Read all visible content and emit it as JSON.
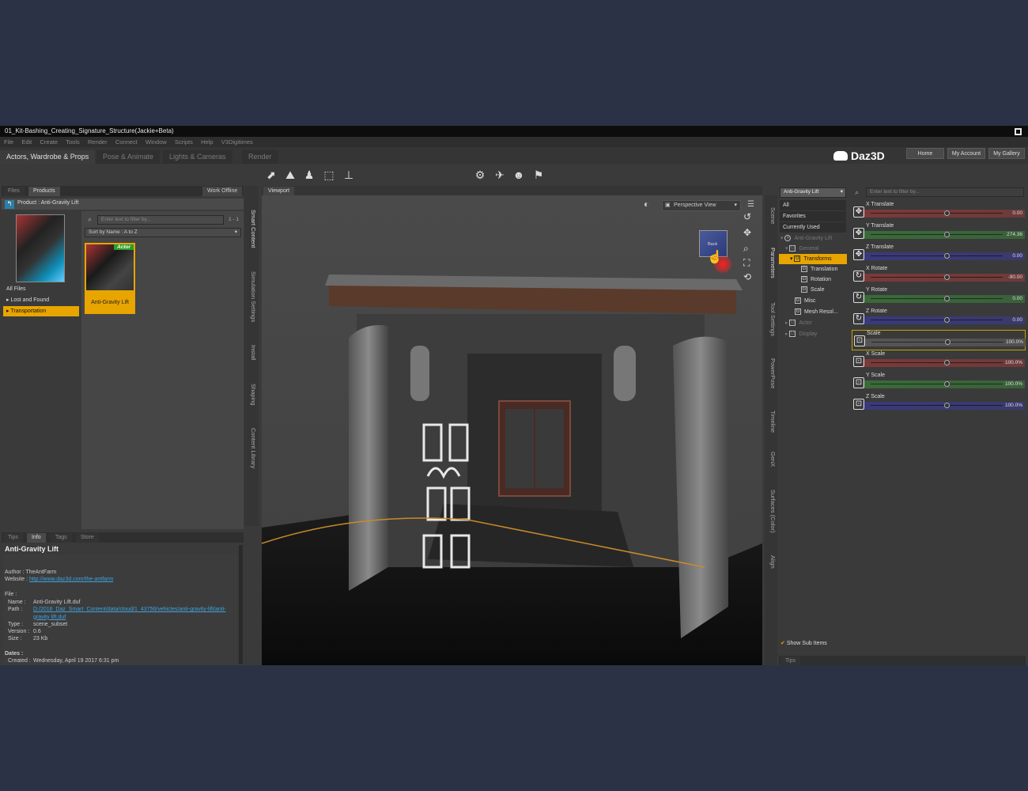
{
  "window": {
    "title": "01_Kit-Bashing_Creating_Signature_Structure(Jackie+Beta)"
  },
  "menu": [
    "File",
    "Edit",
    "Create",
    "Tools",
    "Render",
    "Connect",
    "Window",
    "Scripts",
    "Help",
    "V3Digitimes"
  ],
  "workspace_tabs": [
    "Actors, Wardrobe & Props",
    "Pose & Animate",
    "Lights & Cameras",
    "Render"
  ],
  "brand": {
    "logo": "Daz3D",
    "buttons": [
      "Home",
      "My Account",
      "My Gallery"
    ]
  },
  "left": {
    "tabs": [
      "Files",
      "Products"
    ],
    "work_offline": "Work Offline",
    "product_label": "Product :  Anti-Gravity Lift",
    "filter_placeholder": "Enter text to filter by...",
    "count": "1 - 1",
    "sort": "Sort by Name : A to Z",
    "categories": [
      "All Files",
      "Lost and Found",
      "Transportation"
    ],
    "item": {
      "badge": "Actor",
      "name": "Anti-Gravity Lift"
    },
    "side_tabs": [
      "Smart Content",
      "Simulation Settings",
      "Install",
      "Shaping",
      "Content Library"
    ]
  },
  "info": {
    "tabs": [
      "Tips",
      "Info",
      "Tags",
      "Store"
    ],
    "title": "Anti-Gravity Lift",
    "author_label": "Author :",
    "author": "TheAntFarm",
    "website_label": "Website :",
    "website": "http://www.daz3d.com/the-antfarm",
    "file_label": "File :",
    "name_label": "Name :",
    "name": "Anti-Gravity Lift.duf",
    "path_label": "Path :",
    "path": "D:/2016_Daz_Smart_Content/data/cloud/1_43756/vehicles/anti-gravity-lift/anti-gravity lift.duf",
    "type_label": "Type :",
    "type": "scene_subset",
    "version_label": "Version :",
    "version": "0.6",
    "size_label": "Size :",
    "size": "23 Kb",
    "dates_label": "Dates :",
    "created_label": "Created :",
    "created": "Wednesday, April 19 2017 6:31 pm"
  },
  "viewport": {
    "tab": "Viewport",
    "view": "Perspective View",
    "cube_label": "Back"
  },
  "scene": {
    "selector": "Anti-Gravity Lift",
    "filters": [
      "All",
      "Favorites",
      "Currently Used"
    ],
    "tree": [
      "Anti-Gravity Lift",
      "General",
      "Transforms",
      "Translation",
      "Rotation",
      "Scale",
      "Misc",
      "Mesh Resol...",
      "Actor",
      "Display"
    ],
    "show_sub": "Show Sub Items",
    "bottom_tab": "Tips",
    "side_tabs": [
      "Scene",
      "Parameters",
      "Tool Settings",
      "PowerPose",
      "Timeline",
      "GenX",
      "Surfaces (Color)",
      "Align"
    ]
  },
  "params": {
    "filter_placeholder": "Enter text to filter by...",
    "items": [
      {
        "label": "X Translate",
        "value": "0.00",
        "color": "#7a3a3a"
      },
      {
        "label": "Y Translate",
        "value": "274.36",
        "color": "#3a6a3a"
      },
      {
        "label": "Z Translate",
        "value": "0.00",
        "color": "#3a3a7a"
      },
      {
        "label": "X Rotate",
        "value": "-90.00",
        "color": "#7a3a3a"
      },
      {
        "label": "Y Rotate",
        "value": "0.00",
        "color": "#3a6a3a"
      },
      {
        "label": "Z Rotate",
        "value": "0.00",
        "color": "#3a3a7a"
      },
      {
        "label": "Scale",
        "value": "100.0%",
        "color": "#555555"
      },
      {
        "label": "X Scale",
        "value": "100.0%",
        "color": "#7a3a3a"
      },
      {
        "label": "Y Scale",
        "value": "100.0%",
        "color": "#3a6a3a"
      },
      {
        "label": "Z Scale",
        "value": "100.0%",
        "color": "#3a3a7a"
      }
    ]
  }
}
